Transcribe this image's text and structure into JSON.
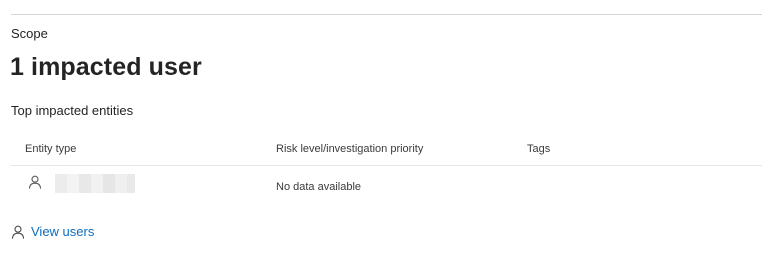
{
  "scope": {
    "label": "Scope",
    "headline": "1 impacted user"
  },
  "entities": {
    "title": "Top impacted entities",
    "columns": [
      "Entity type",
      "Risk level/investigation priority",
      "Tags"
    ],
    "rows": [
      {
        "entity_icon": "user-icon",
        "entity_name": "",
        "risk": "No data available",
        "tags": ""
      }
    ]
  },
  "actions": {
    "view_users_label": "View users",
    "view_users_icon": "user-icon"
  },
  "colors": {
    "text": "#242424",
    "link": "#0f6cbd",
    "divider": "#d6d6d6"
  }
}
